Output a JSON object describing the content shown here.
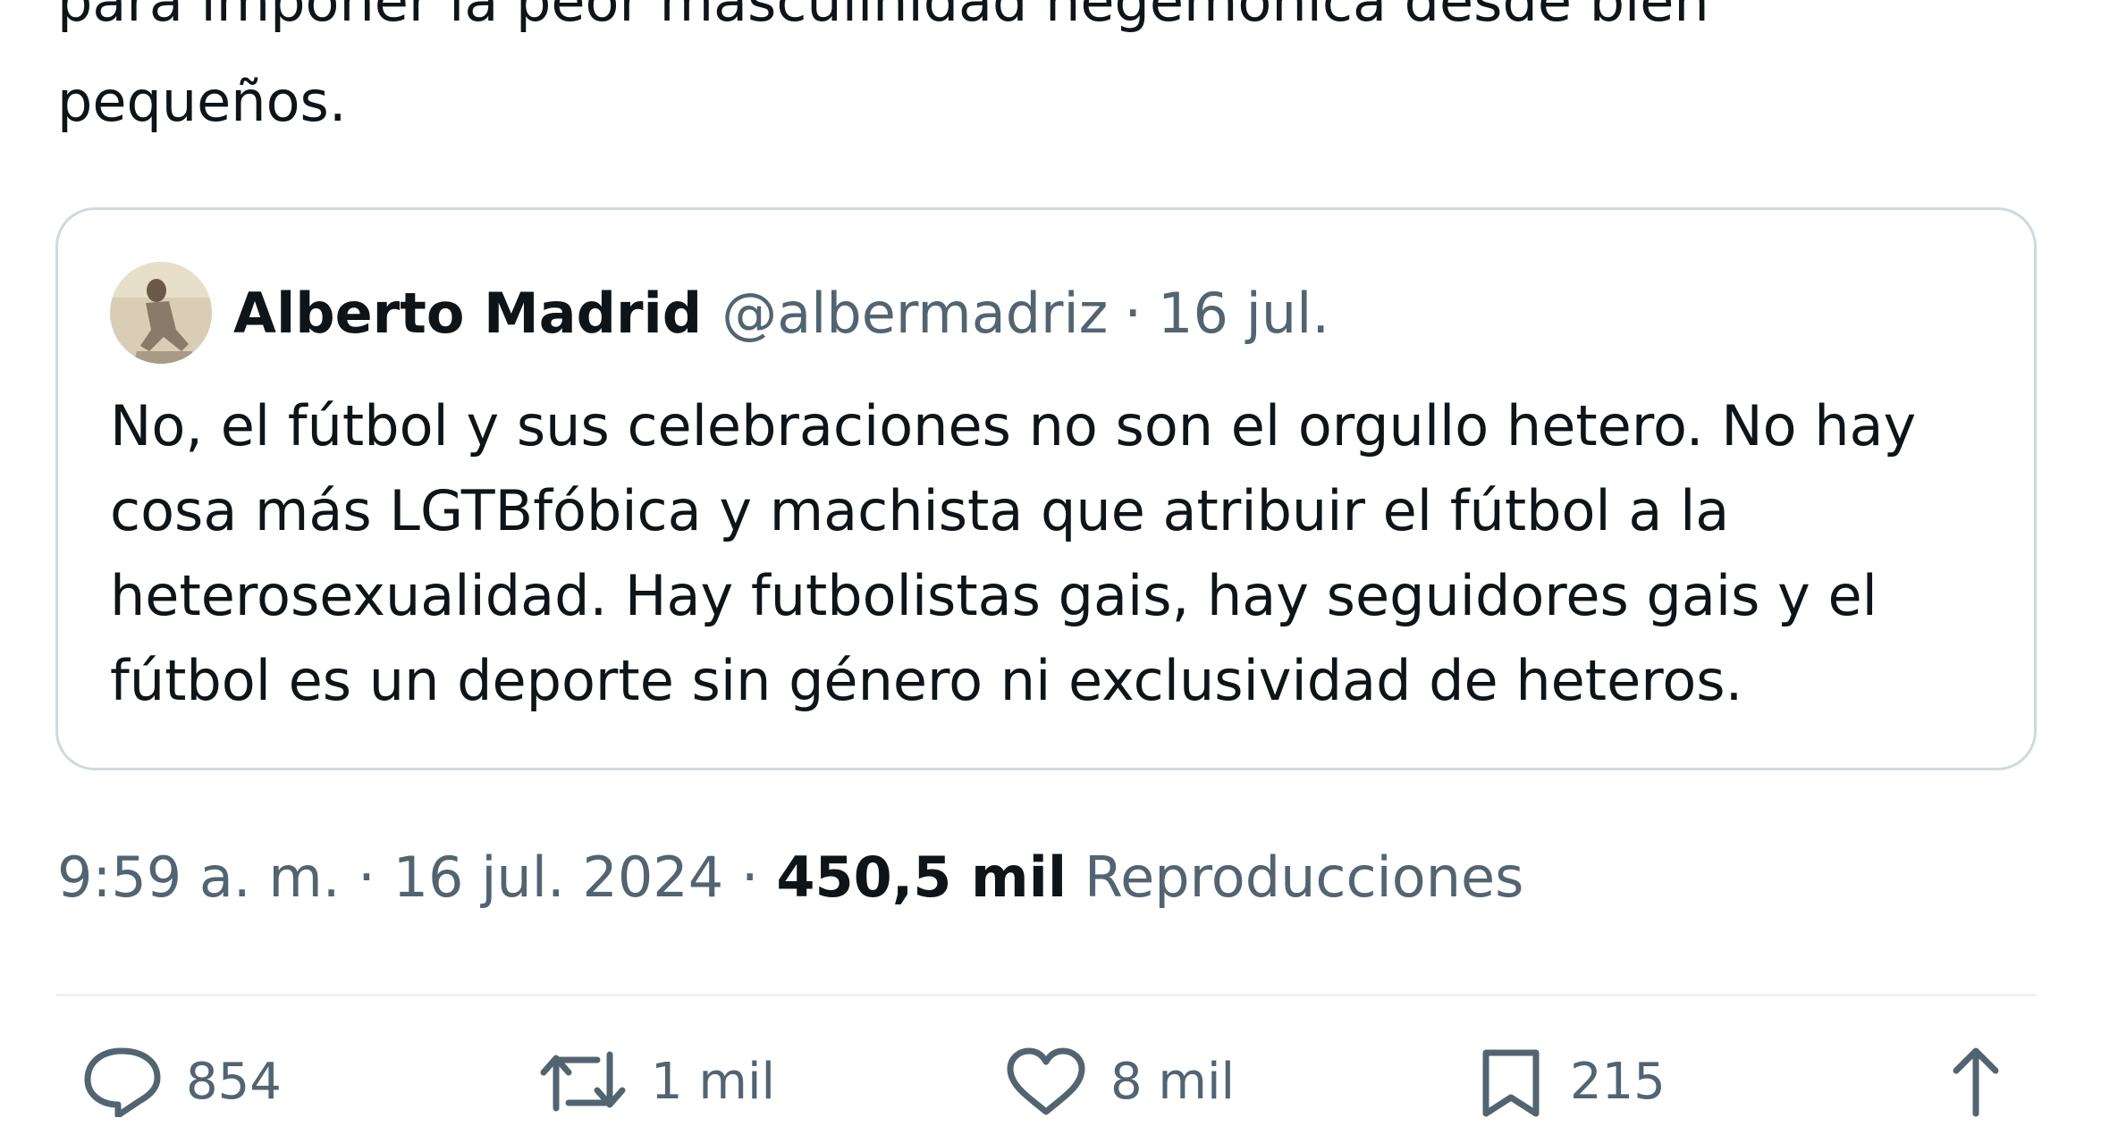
{
  "tweet": {
    "text_line_1": "para imponer la peor masculinidad hegemónica desde bien",
    "text_line_2": "pequeños."
  },
  "quoted_tweet": {
    "author_name": "Alberto Madrid",
    "author_handle": "@albermadriz",
    "separator": "·",
    "date": "16 jul.",
    "body_lines": [
      "No, el fútbol y sus celebraciones no son el orgullo hetero. No hay",
      "cosa más LGTBfóbica y machista que atribuir el fútbol a la",
      "heterosexualidad. Hay futbolistas gais, hay seguidores gais y el",
      "fútbol es un deporte sin género ni exclusividad de heteros."
    ]
  },
  "meta": {
    "time": "9:59 a. m.",
    "separator": "·",
    "date": "16 jul. 2024",
    "views_count": "450,5 mil",
    "views_label": "Reproducciones"
  },
  "actions": {
    "replies": "854",
    "reposts": "1 mil",
    "likes": "8 mil",
    "bookmarks": "215"
  },
  "icons": {
    "reply": "reply-icon",
    "repost": "repost-icon",
    "like": "heart-icon",
    "bookmark": "bookmark-icon",
    "share": "share-icon"
  },
  "colors": {
    "text_primary": "#0f1419",
    "text_secondary": "#536471",
    "border": "#cfd9de"
  }
}
